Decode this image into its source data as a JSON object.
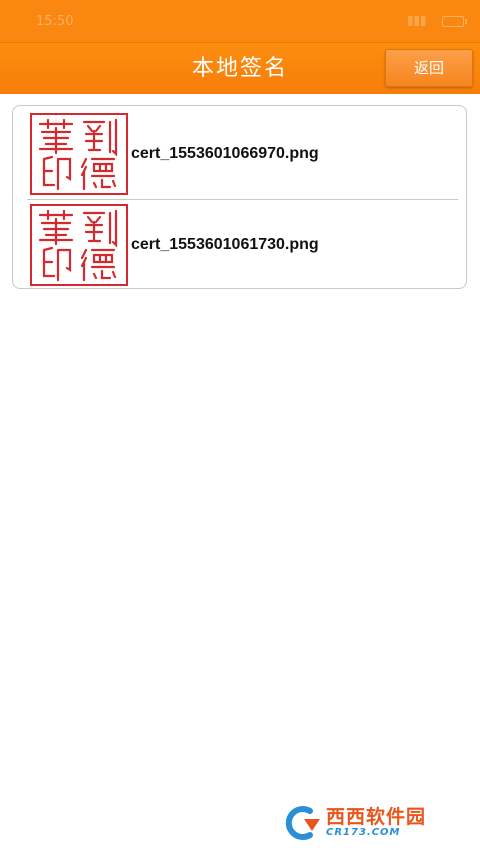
{
  "status_bar": {
    "time": "15:50"
  },
  "header": {
    "title": "本地签名",
    "back_label": "返回"
  },
  "files": [
    {
      "name": "cert_1553601066970.png",
      "seal_text": "劉德華印"
    },
    {
      "name": "cert_1553601061730.png",
      "seal_text": "劉德華印"
    }
  ],
  "watermark": {
    "title": "西西软件园",
    "subtitle": "CR173.COM"
  },
  "colors": {
    "header_orange": "#f98710",
    "seal_red": "#d4292f",
    "watermark_orange": "#e8561b",
    "watermark_blue": "#2b8fd6"
  }
}
